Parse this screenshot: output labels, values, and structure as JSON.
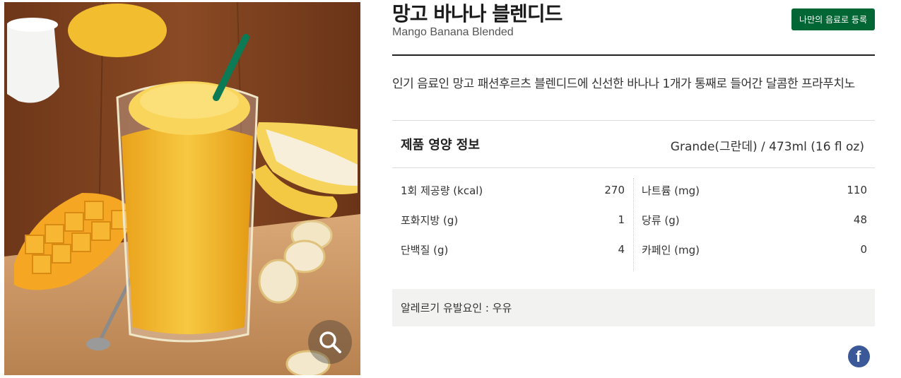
{
  "product": {
    "name_ko": "망고 바나나 블렌디드",
    "name_en": "Mango Banana Blended",
    "register_button": "나만의 음료로 등록",
    "description": "인기 음료인 망고 패션후르츠 블렌디드에 신선한 바나나 1개가 통째로 들어간 달콤한 프라푸치노"
  },
  "image": {
    "zoom_icon": "magnifier-icon"
  },
  "nutrition": {
    "title": "제품 영양 정보",
    "size": "Grande(그란데) / 473ml (16 fl oz)",
    "left_rows": [
      {
        "label": "1회 제공량 (kcal)",
        "value": "270"
      },
      {
        "label": "포화지방 (g)",
        "value": "1"
      },
      {
        "label": "단백질 (g)",
        "value": "4"
      }
    ],
    "right_rows": [
      {
        "label": "나트륨 (mg)",
        "value": "110"
      },
      {
        "label": "당류 (g)",
        "value": "48"
      },
      {
        "label": "카페인 (mg)",
        "value": "0"
      }
    ]
  },
  "allergy": "알레르기 유발요인 : 우유",
  "share": {
    "facebook_icon": "facebook-icon"
  },
  "colors": {
    "accent": "#006633",
    "facebook": "#3b5998",
    "allergy_bg": "#f2f2f0"
  }
}
